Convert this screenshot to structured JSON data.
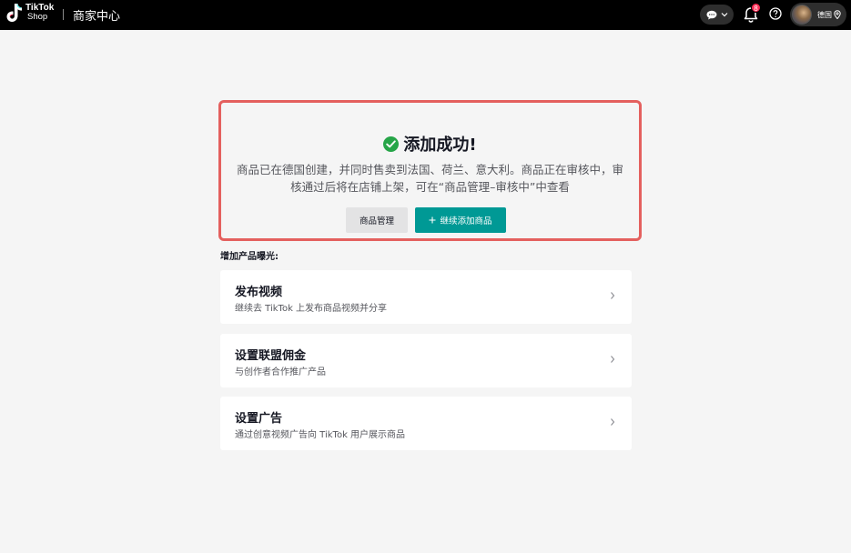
{
  "header": {
    "logo_line1": "TikTok",
    "logo_line2": "Shop",
    "title": "商家中心",
    "notification_count": "8",
    "region": "德国"
  },
  "success": {
    "title": "添加成功!",
    "description_line1": "商品已在德国创建，并同时售卖到法国、荷兰、意大利。商品正在审核中，审",
    "description_line2": "核通过后将在店铺上架，可在“商品管理–审核中”中查看",
    "manage_button": "商品管理",
    "add_more_button": "继续添加商品"
  },
  "exposure": {
    "label": "增加产品曝光:",
    "cards": [
      {
        "title": "发布视频",
        "subtitle": "继续去 TikTok 上发布商品视频并分享"
      },
      {
        "title": "设置联盟佣金",
        "subtitle": "与创作者合作推广产品"
      },
      {
        "title": "设置广告",
        "subtitle": "通过创意视频广告向 TikTok 用户展示商品"
      }
    ]
  },
  "colors": {
    "primary": "#009995",
    "success": "#26a548",
    "highlight_border": "#e4605e",
    "badge": "#fe2c55"
  }
}
